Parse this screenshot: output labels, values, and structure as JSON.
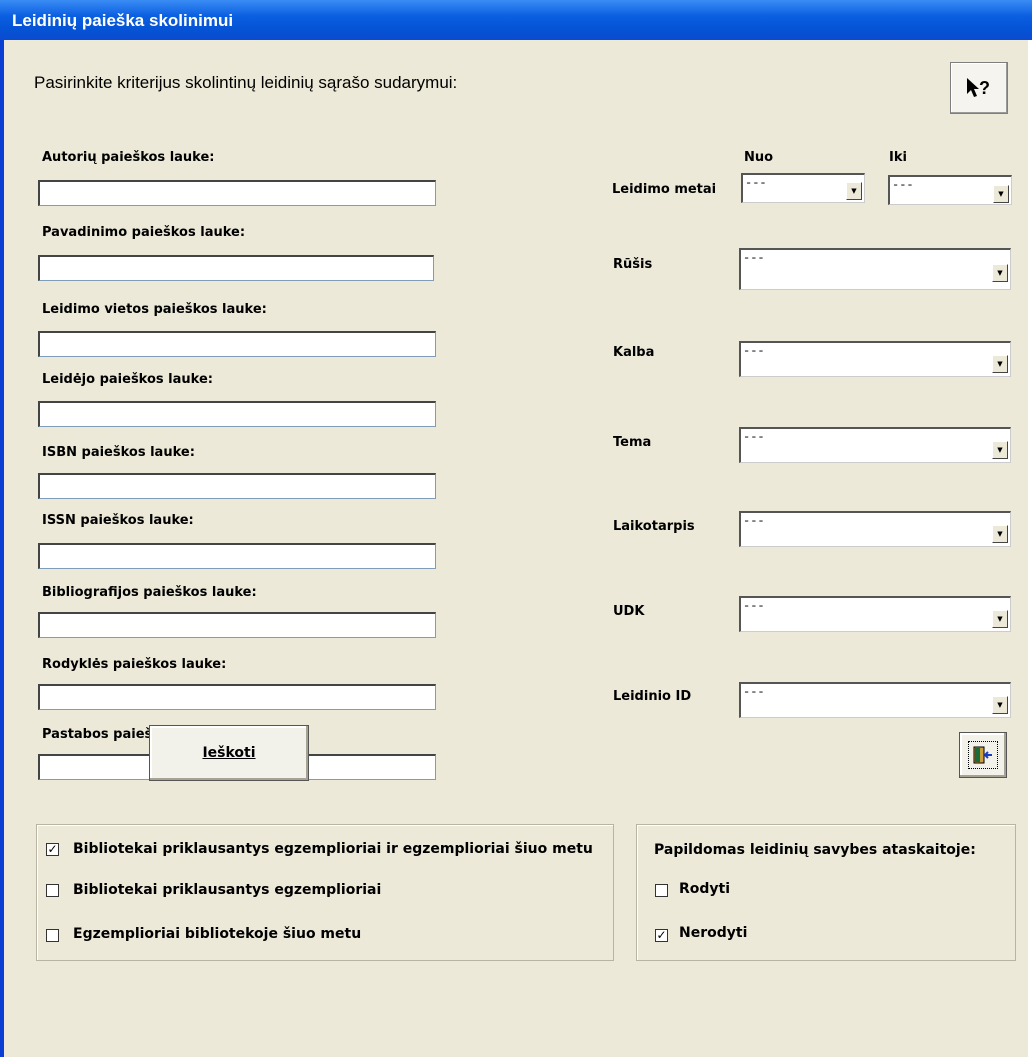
{
  "window": {
    "title": "Leidinių paieška skolinimui"
  },
  "heading": "Pasirinkite kriterijus skolintinų leidinių sąrašo sudarymui:",
  "help_button": {
    "label": "?"
  },
  "left_fields": [
    {
      "label": "Autorių paieškos lauke:",
      "value": ""
    },
    {
      "label": "Pavadinimo paieškos lauke:",
      "value": ""
    },
    {
      "label": "Leidimo vietos paieškos lauke:",
      "value": ""
    },
    {
      "label": "Leidėjo paieškos lauke:",
      "value": ""
    },
    {
      "label": "ISBN paieškos lauke:",
      "value": ""
    },
    {
      "label": "ISSN paieškos lauke:",
      "value": ""
    },
    {
      "label": "Bibliografijos paieškos lauke:",
      "value": ""
    },
    {
      "label": "Rodyklės paieškos lauke:",
      "value": ""
    },
    {
      "label": "Pastabos paieškos lauke:",
      "value": ""
    }
  ],
  "year": {
    "label": "Leidimo metai",
    "from_label": "Nuo",
    "to_label": "Iki",
    "from_value": "---",
    "to_value": "---"
  },
  "right_fields": [
    {
      "label": "Rūšis",
      "value": "---"
    },
    {
      "label": "Kalba",
      "value": "---"
    },
    {
      "label": "Tema",
      "value": "---"
    },
    {
      "label": "Laikotarpis",
      "value": "---"
    },
    {
      "label": "UDK",
      "value": "---"
    },
    {
      "label": "Leidinio ID",
      "value": "---"
    }
  ],
  "copies_group": {
    "options": [
      {
        "label": "Bibliotekai priklausantys egzemplioriai ir egzemplioriai šiuo metu",
        "checked": true,
        "mark": "✓"
      },
      {
        "label": "Bibliotekai priklausantys egzemplioriai",
        "checked": false,
        "mark": ""
      },
      {
        "label": "Egzemplioriai bibliotekoje šiuo metu",
        "checked": false,
        "mark": ""
      }
    ]
  },
  "props_group": {
    "title": "Papildomas leidinių savybes ataskaitoje:",
    "options": [
      {
        "label": "Rodyti",
        "checked": false,
        "mark": ""
      },
      {
        "label": "Nerodyti",
        "checked": true,
        "mark": "✓"
      }
    ]
  },
  "search_button": {
    "label": "Ieškoti"
  }
}
